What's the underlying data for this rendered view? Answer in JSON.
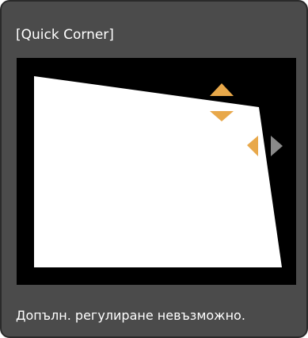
{
  "dialog": {
    "title": "[Quick Corner]",
    "message": "Допълн. регулиране невъзможно."
  },
  "icons": {
    "up": "arrow-up-icon",
    "down": "arrow-down-icon",
    "left": "arrow-left-icon",
    "right": "arrow-right-icon"
  },
  "colors": {
    "panel_bg": "#4b4b4b",
    "screen_bg": "#000000",
    "image_fill": "#ffffff",
    "active_arrow": "#e8a84a",
    "inactive_arrow": "#8a8a8a"
  }
}
